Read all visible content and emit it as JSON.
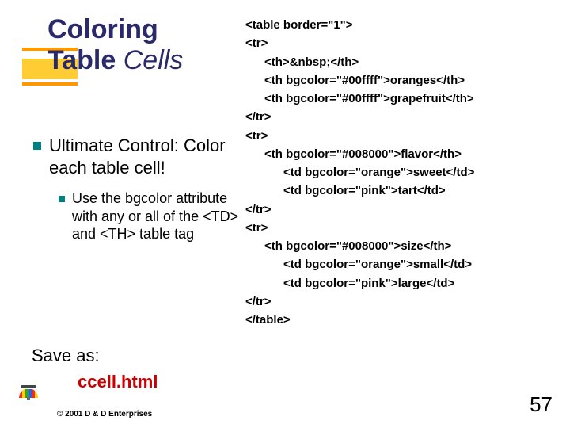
{
  "title": {
    "line1": "Coloring",
    "line2_a": "Table ",
    "line2_b": "Cells"
  },
  "bullets": {
    "l1": "Ultimate Control: Color each table cell!",
    "l2": "Use the bgcolor attribute with any or all of the <TD> and <TH> table tag"
  },
  "save": {
    "label": "Save as:",
    "filename": "ccell.html"
  },
  "copyright": "© 2001 D & D Enterprises",
  "code": {
    "c00": "<table border=\"1\">",
    "c01": "<tr>",
    "c02": "<th>&nbsp;</th>",
    "c03": "<th bgcolor=\"#00ffff\">oranges</th>",
    "c04": "<th bgcolor=\"#00ffff\">grapefruit</th>",
    "c05": "</tr>",
    "c06": "<tr>",
    "c07": "<th bgcolor=\"#008000\">flavor</th>",
    "c08": "<td bgcolor=\"orange\">sweet</td>",
    "c09": "<td bgcolor=\"pink\">tart</td>",
    "c10": "</tr>",
    "c11": "<tr>",
    "c12": "<th bgcolor=\"#008000\">size</th>",
    "c13": "<td bgcolor=\"orange\">small</td>",
    "c14": "<td bgcolor=\"pink\">large</td>",
    "c15": "</tr>",
    "c16": "</table>"
  },
  "page_number": "57"
}
